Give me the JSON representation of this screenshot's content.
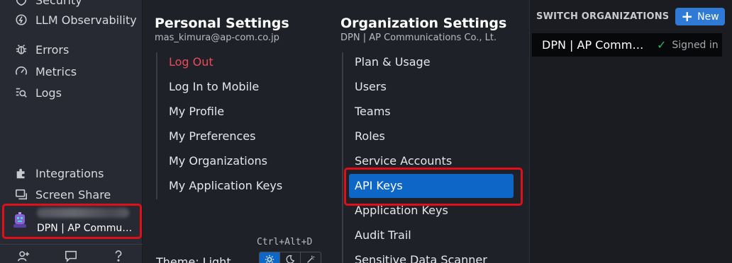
{
  "sidebar": {
    "items": [
      {
        "label": "Security",
        "icon": "shield-icon"
      },
      {
        "label": "LLM Observability",
        "icon": "llm-icon"
      },
      {
        "label": "Errors",
        "icon": "bug-icon"
      },
      {
        "label": "Metrics",
        "icon": "gauge-icon"
      },
      {
        "label": "Logs",
        "icon": "logs-icon"
      },
      {
        "label": "Integrations",
        "icon": "puzzle-icon"
      },
      {
        "label": "Screen Share",
        "icon": "screen-share-icon"
      }
    ],
    "org_label": "DPN | AP Communications Co., Lt.",
    "bottom_icons": [
      "add-user-icon",
      "chat-icon",
      "help-icon"
    ]
  },
  "personal": {
    "title": "Personal Settings",
    "email": "mas_kimura@ap-com.co.jp",
    "items": [
      "Log Out",
      "Log In to Mobile",
      "My Profile",
      "My Preferences",
      "My Organizations",
      "My Application Keys"
    ]
  },
  "organization": {
    "title": "Organization Settings",
    "subtitle": "DPN | AP Communications Co., Lt.",
    "items": [
      "Plan & Usage",
      "Users",
      "Teams",
      "Roles",
      "Service Accounts",
      "API Keys",
      "Application Keys",
      "Audit Trail",
      "Sensitive Data Scanner"
    ],
    "selected": "API Keys"
  },
  "theme": {
    "shortcut": "Ctrl+Alt+D",
    "label": "Theme: Light",
    "options": [
      "light",
      "dark",
      "auto"
    ],
    "active": "light"
  },
  "switch_orgs": {
    "title": "SWITCH ORGANIZATIONS",
    "new_label": "New",
    "orgs": [
      {
        "name": "DPN | AP Communications Co., Lt.",
        "status": "Signed in"
      }
    ]
  },
  "colors": {
    "accent": "#0e67c6",
    "highlight_border": "#e0101a",
    "logout": "#ec4a56",
    "signed_in_check": "#2fb56b"
  }
}
